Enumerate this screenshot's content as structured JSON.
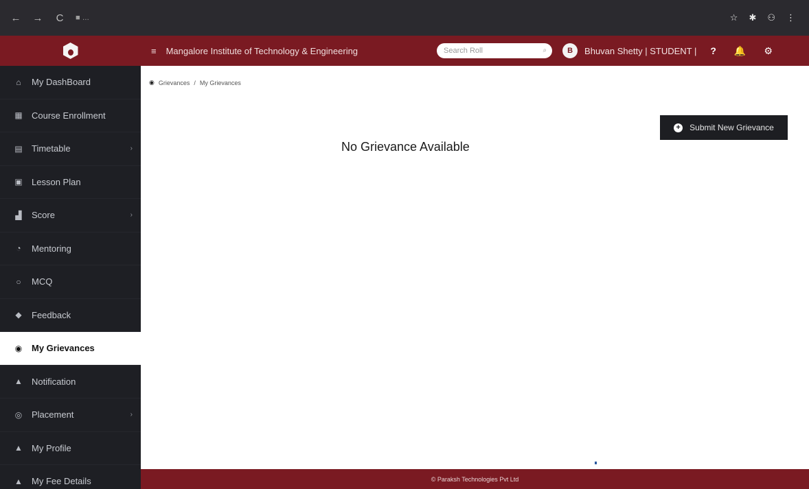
{
  "browser": {
    "back": "←",
    "forward": "→",
    "reload": "C",
    "url": "■ ...",
    "ext_icons": [
      "☆",
      "✱",
      "⚇",
      "⋮"
    ]
  },
  "header": {
    "menu_icon": "≡",
    "college_name": "Mangalore Institute of Technology & Engineering",
    "search_placeholder": "Search Roll",
    "avatar_initial": "B",
    "user_name": "Bhuvan Shetty | STUDENT |",
    "help_icon": "?",
    "bell_icon": "🔔",
    "settings_icon": "⚙"
  },
  "sidebar": {
    "items": [
      {
        "label": "My DashBoard",
        "icon": "⌂"
      },
      {
        "label": "Course Enrollment",
        "icon": "▦"
      },
      {
        "label": "Timetable",
        "icon": "▤",
        "chevron": "›"
      },
      {
        "label": "Lesson Plan",
        "icon": "▣"
      },
      {
        "label": "Score",
        "icon": "▟",
        "chevron": "›"
      },
      {
        "label": "Mentoring",
        "icon": "◔"
      },
      {
        "label": "MCQ",
        "icon": "○"
      },
      {
        "label": "Feedback",
        "icon": "◆"
      },
      {
        "label": "My Grievances",
        "icon": "◉"
      },
      {
        "label": "Notification",
        "icon": "▲"
      },
      {
        "label": "Placement",
        "icon": "◎",
        "chevron": "›"
      },
      {
        "label": "My Profile",
        "icon": "▲"
      },
      {
        "label": "My Fee Details",
        "icon": "▲"
      }
    ]
  },
  "main": {
    "breadcrumb": [
      "Grievances",
      "My Grievances"
    ],
    "submit_label": "Submit New Grievance",
    "submit_icon": "+",
    "empty_message": "No Grievance Available"
  },
  "footer": {
    "text": "© Paraksh Technologies Pvt Ltd"
  }
}
